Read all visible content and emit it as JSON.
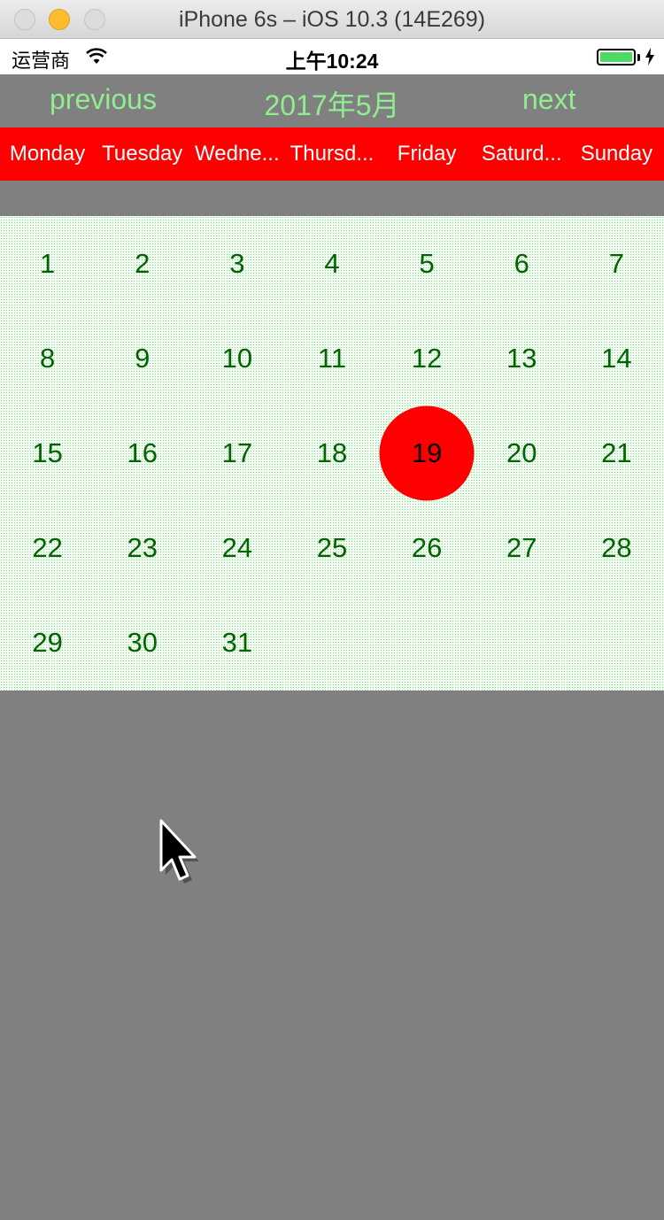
{
  "window": {
    "title": "iPhone 6s – iOS 10.3 (14E269)"
  },
  "statusbar": {
    "carrier": "运营商",
    "time": "上午10:24"
  },
  "calendar": {
    "prev_label": "previous",
    "next_label": "next",
    "month_title": "2017年5月",
    "weekdays": [
      "Monday",
      "Tuesday",
      "Wedne...",
      "Thursd...",
      "Friday",
      "Saturd...",
      "Sunday"
    ],
    "days": [
      "1",
      "2",
      "3",
      "4",
      "5",
      "6",
      "7",
      "8",
      "9",
      "10",
      "11",
      "12",
      "13",
      "14",
      "15",
      "16",
      "17",
      "18",
      "19",
      "20",
      "21",
      "22",
      "23",
      "24",
      "25",
      "26",
      "27",
      "28",
      "29",
      "30",
      "31"
    ],
    "selected_day": "19"
  },
  "colors": {
    "background": "#808080",
    "header_text": "#90ee90",
    "weekday_bar": "#ff0000",
    "day_text": "#006400",
    "selected_circle": "#ff0000"
  }
}
